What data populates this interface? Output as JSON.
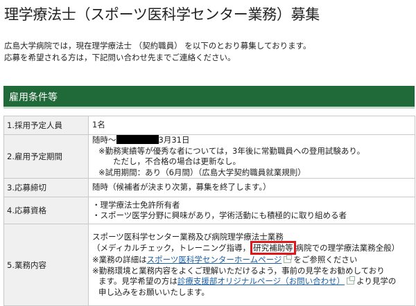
{
  "page": {
    "title": "理学療法士（スポーツ医科学センター業務）募集",
    "intro_line1": "広島大学病院では，現在理学療法士 （契約職員） を以下のとおり募集しております。",
    "intro_line2": "応募を希望される方は，下記問い合わせ先までご連絡ください。"
  },
  "section": {
    "heading": "雇用条件等"
  },
  "rows": [
    {
      "label": "1.採用予定人員",
      "lines": [
        "1名"
      ]
    },
    {
      "label": "2.雇用予定期間",
      "period_prefix": "随時～",
      "period_suffix": "3月31日",
      "lines": [
        "※勤務実績等が優秀な者については，3年後に常勤職員への登用試験あり。",
        "ただし，不合格の場合は更新なし。",
        "※試用期間：あり（6月間）（広島大学契約職員就業規則）"
      ]
    },
    {
      "label": "3.応募締切",
      "lines": [
        "随時（候補者が決まり次第，募集を終了します。）"
      ]
    },
    {
      "label": "4.応募資格",
      "lines": [
        "・理学療法士免許所有者",
        "・スポーツ医学分野に興味があり，学術活動にも積極的に取り組める者"
      ]
    },
    {
      "label": "5.業務内容",
      "line1": "スポーツ医科学センター業務及び病院理学療法士業務",
      "line2_before": "（メディカルチェック，トレーニング指導，",
      "line2_highlight": "研究補助等",
      "line2_after": "病院での理学療法業務全般）",
      "line3_before": "※業務の詳細は",
      "line3_link": "スポーツ医科学センターホームページ",
      "line3_after": "をご参照ください",
      "line4": "※勤務環境と業務内容をよくご理解いただけるよう，事前の見学をお勧めしており",
      "line5_before": "ます。見学希望の方は",
      "line5_link": "診療支援部オリジナルページ（お問い合わせ）",
      "line5_after": "より見学の",
      "line6": "申し込みをお願いいたします。"
    }
  ],
  "icons": {
    "external_link": "external-link-icon"
  },
  "colors": {
    "section_bar": "#206a3a",
    "highlight_border": "#e0161b",
    "link": "#1a5ea8"
  }
}
